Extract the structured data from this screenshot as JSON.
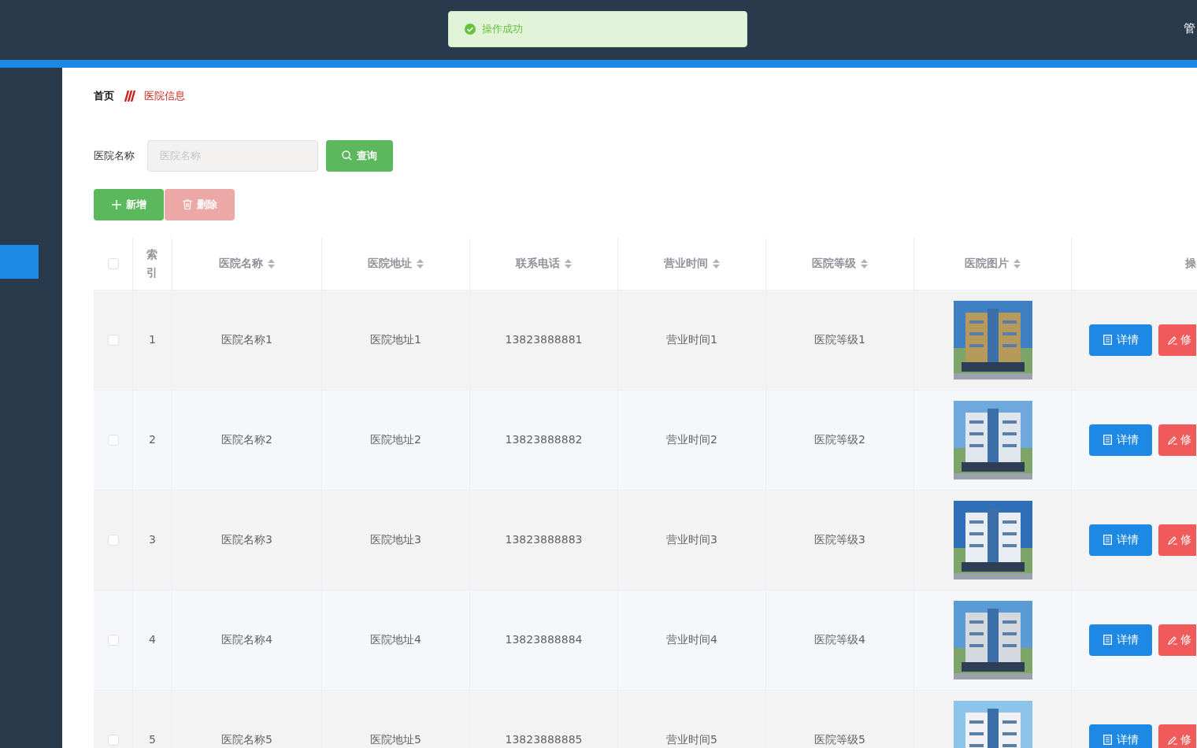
{
  "header": {
    "user_text": "管"
  },
  "toast": {
    "message": "操作成功"
  },
  "sidebar": {
    "items": [
      {
        "selected": true
      }
    ]
  },
  "breadcrumb": [
    {
      "label": "首页",
      "selected": false
    },
    {
      "label": "医院信息",
      "selected": true
    }
  ],
  "search": {
    "label": "医院名称",
    "placeholder": "医院名称",
    "button": "查询"
  },
  "actions": [
    {
      "label": "新增",
      "kind": "add",
      "disabled": false
    },
    {
      "label": "删除",
      "kind": "delete",
      "disabled": true
    }
  ],
  "table": {
    "all_checked": false,
    "columns": [
      "索引",
      "医院名称",
      "医院地址",
      "联系电话",
      "营业时间",
      "医院等级",
      "医院图片",
      "操"
    ],
    "rows": [
      {
        "checked": false,
        "index": "1",
        "name": "医院名称1",
        "address": "医院地址1",
        "phone": "13823888881",
        "hours": "营业时间1",
        "level": "医院等级1",
        "buttons": [
          "详情",
          "修"
        ]
      },
      {
        "checked": false,
        "index": "2",
        "name": "医院名称2",
        "address": "医院地址2",
        "phone": "13823888882",
        "hours": "营业时间2",
        "level": "医院等级2",
        "buttons": [
          "详情",
          "修"
        ]
      },
      {
        "checked": false,
        "index": "3",
        "name": "医院名称3",
        "address": "医院地址3",
        "phone": "13823888883",
        "hours": "营业时间3",
        "level": "医院等级3",
        "buttons": [
          "详情",
          "修"
        ]
      },
      {
        "checked": false,
        "index": "4",
        "name": "医院名称4",
        "address": "医院地址4",
        "phone": "13823888884",
        "hours": "营业时间4",
        "level": "医院等级4",
        "buttons": [
          "详情",
          "修"
        ]
      },
      {
        "checked": false,
        "index": "5",
        "name": "医院名称5",
        "address": "医院地址5",
        "phone": "13823888885",
        "hours": "营业时间5",
        "level": "医院等级5",
        "buttons": [
          "详情",
          "修"
        ]
      }
    ]
  }
}
